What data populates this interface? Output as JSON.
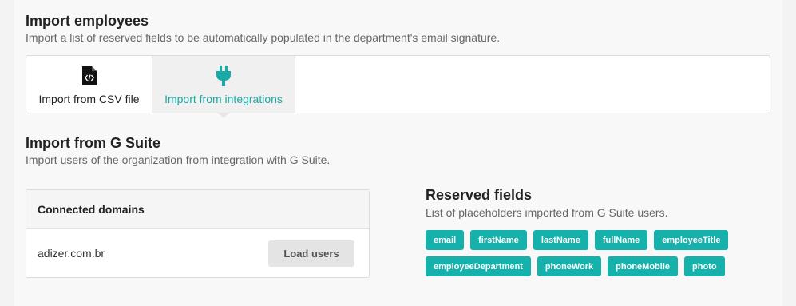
{
  "header": {
    "title": "Import employees",
    "subtitle": "Import a list of reserved fields to be automatically populated in the department's email signature."
  },
  "tabs": [
    {
      "label": "Import from CSV file",
      "icon": "code-file-icon",
      "active": false
    },
    {
      "label": "Import from integrations",
      "icon": "plug-icon",
      "active": true
    }
  ],
  "gsuite": {
    "title": "Import from G Suite",
    "subtitle": "Import users of the organization from integration with G Suite."
  },
  "domains": {
    "header": "Connected domains",
    "rows": [
      {
        "domain": "adizer.com.br",
        "action_label": "Load users"
      }
    ]
  },
  "reserved": {
    "title": "Reserved fields",
    "subtitle": "List of placeholders imported from G Suite users.",
    "row1": [
      "email",
      "firstName",
      "lastName",
      "fullName",
      "employeeTitle"
    ],
    "row2": [
      "employeeDepartment",
      "phoneWork",
      "phoneMobile",
      "photo"
    ]
  },
  "colors": {
    "accent": "#17b1ac",
    "active_tab_text": "#17aaa6"
  }
}
